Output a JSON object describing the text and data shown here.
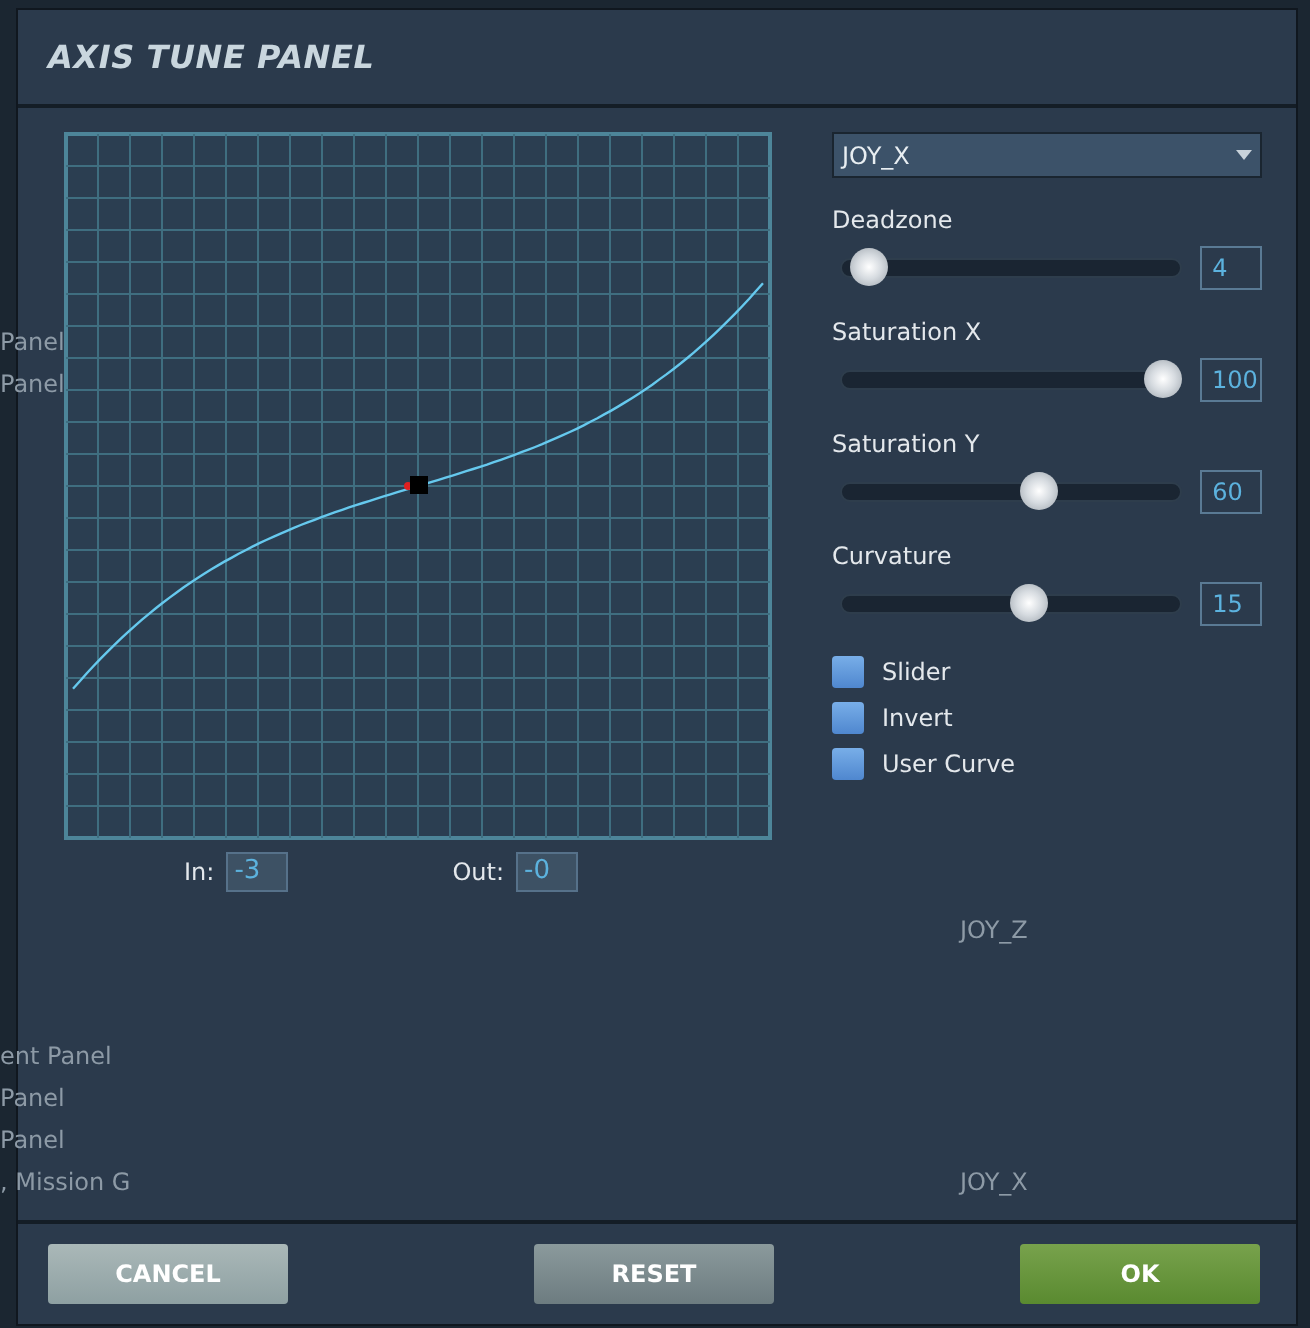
{
  "background_rows": [
    {
      "column_1": "Panel",
      "column_2": ""
    },
    {
      "column_1": "Panel",
      "column_2": ""
    },
    {
      "column_1": "",
      "column_2": "JOY_Z"
    },
    {
      "column_1": "ent Panel",
      "column_2": ""
    },
    {
      "column_1": "Panel",
      "column_2": ""
    },
    {
      "column_1": "Panel",
      "column_2": ""
    },
    {
      "column_1": ", Mission G",
      "column_2": "JOY_X"
    }
  ],
  "window": {
    "title": "AXIS TUNE PANEL"
  },
  "graph": {
    "in_label": "In:",
    "in_value": "-3",
    "out_label": "Out:",
    "out_value": "-0"
  },
  "axis_select": {
    "value": "JOY_X"
  },
  "sliders": [
    {
      "label": "Deadzone",
      "level": 0.03,
      "value": "4"
    },
    {
      "label": "Saturation X",
      "level": 1,
      "value": "100"
    },
    {
      "label": "Saturation Y",
      "level": 0.59,
      "value": "60"
    },
    {
      "label": "Curvature",
      "level": 0.56,
      "value": "15"
    }
  ],
  "checkboxes": [
    {
      "label": "Slider",
      "checked": false
    },
    {
      "label": "Invert",
      "checked": false
    },
    {
      "label": "User Curve",
      "checked": false
    }
  ],
  "buttons": [
    {
      "label": "CANCEL",
      "kind": "cancel"
    },
    {
      "label": "RESET",
      "kind": "reset"
    },
    {
      "label": "OK",
      "kind": "ok"
    }
  ]
}
